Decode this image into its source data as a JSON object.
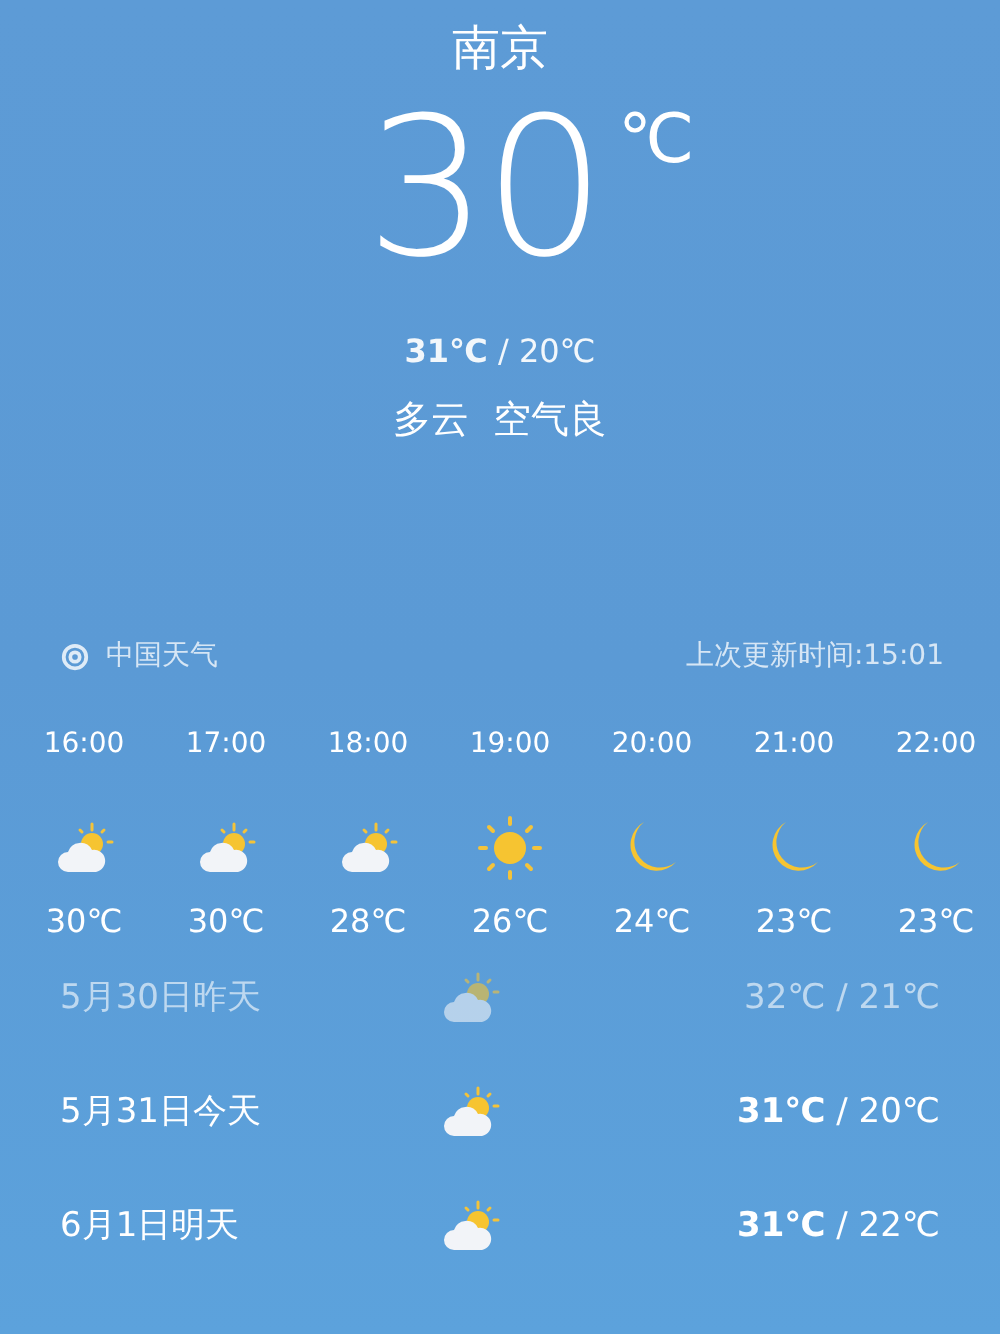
{
  "current": {
    "city": "南京",
    "temperature": "30",
    "unit": "℃",
    "range": "**31℃** / 20℃",
    "description": "多云  空气良"
  },
  "source": {
    "name": "中国天气",
    "updated": "上次更新时间:15:01"
  },
  "hourly": [
    {
      "time": "16:00",
      "kind": "partly_cloudy",
      "temp": "30℃"
    },
    {
      "time": "17:00",
      "kind": "partly_cloudy",
      "temp": "30℃"
    },
    {
      "time": "18:00",
      "kind": "partly_cloudy",
      "temp": "28℃"
    },
    {
      "time": "19:00",
      "kind": "sunny",
      "temp": "26℃"
    },
    {
      "time": "20:00",
      "kind": "moon",
      "temp": "24℃"
    },
    {
      "time": "21:00",
      "kind": "moon",
      "temp": "23℃"
    },
    {
      "time": "22:00",
      "kind": "moon",
      "temp": "23℃"
    }
  ],
  "daily": [
    {
      "date": "5月30日昨天",
      "kind": "partly_cloudy",
      "range": "32℃ / 21℃",
      "past": true
    },
    {
      "date": "5月31日今天",
      "kind": "partly_cloudy",
      "range": "**31℃** / 20℃",
      "past": false
    },
    {
      "date": "6月1日明天",
      "kind": "partly_cloudy",
      "range": "**31℃** / 22℃",
      "past": false
    }
  ]
}
